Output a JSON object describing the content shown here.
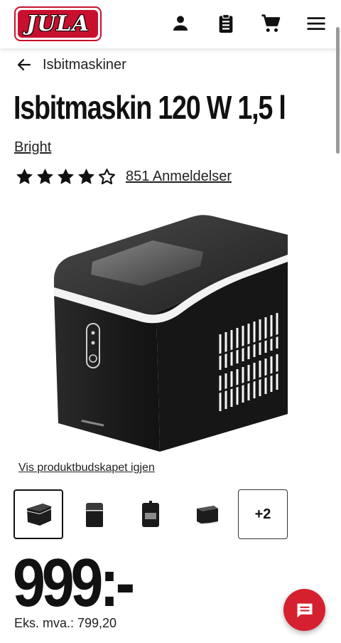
{
  "header": {
    "logo_text": "JULA",
    "icons": [
      "account-icon",
      "clipboard-list-icon",
      "cart-icon",
      "menu-icon"
    ]
  },
  "breadcrumb": {
    "back_icon": "arrow-left-icon",
    "label": "Isbitmaskiner"
  },
  "product": {
    "title": "Isbitmaskin 120 W 1,5 l",
    "brand": "Bright",
    "rating": 4,
    "rating_max": 5,
    "reviews_label": "851 Anmeldelser",
    "video_link": "Vis produktbudskapet igjen",
    "thumbnails_more": "+2",
    "price": "999:-",
    "price_ex_vat": "Eks. mva.: 799,20"
  },
  "colors": {
    "brand_red": "#c8102e",
    "chat_button": "#d4202f",
    "text": "#111111"
  },
  "chat": {
    "icon": "chat-icon"
  }
}
